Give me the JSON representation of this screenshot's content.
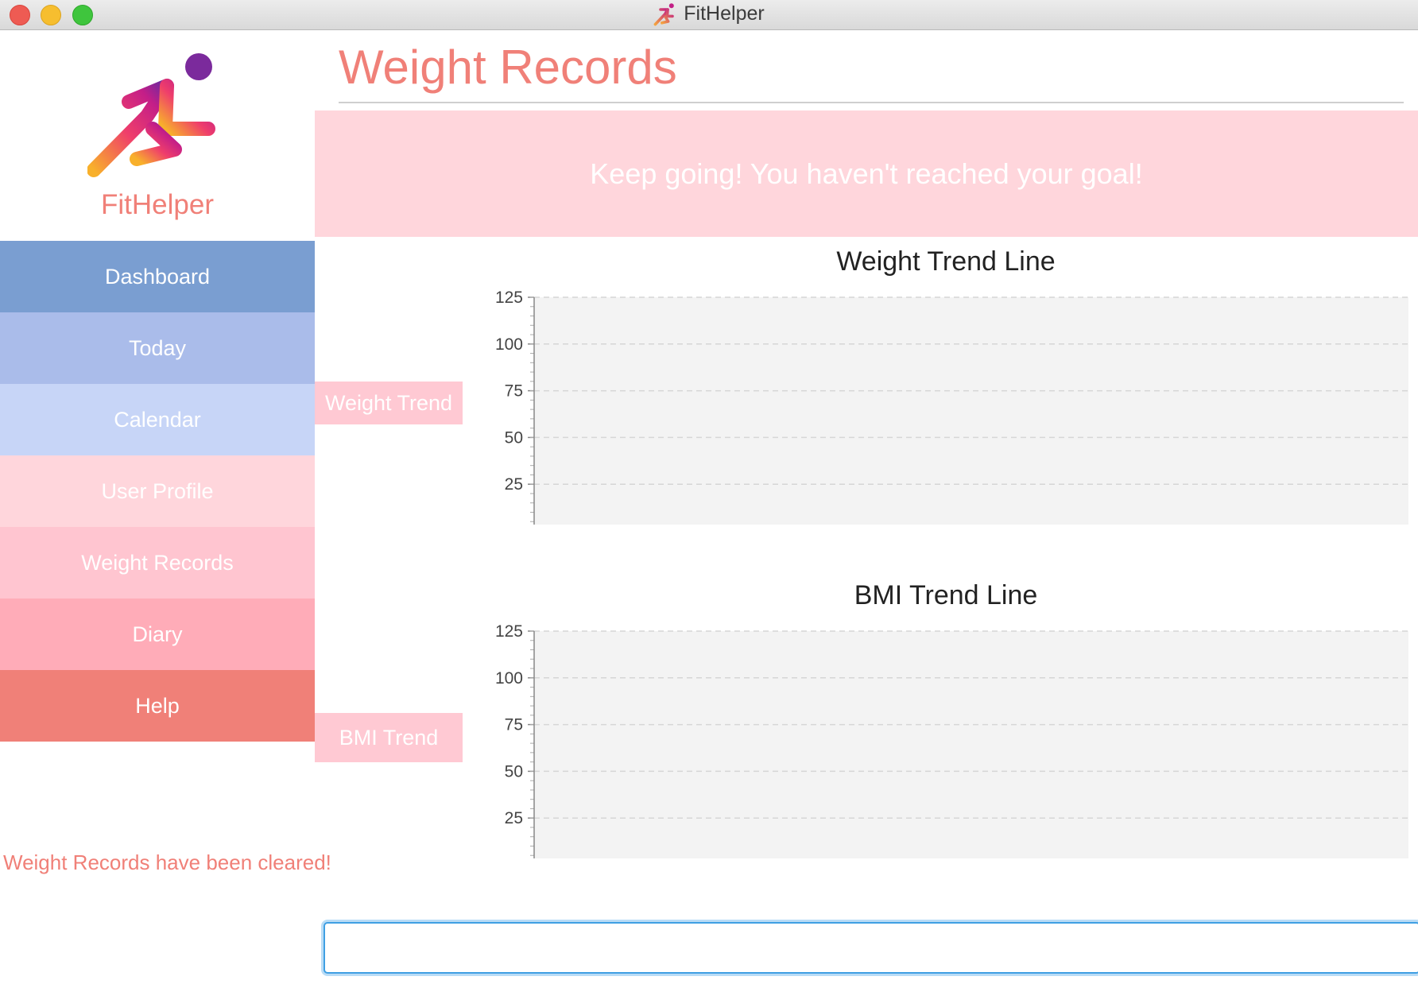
{
  "window": {
    "title": "FitHelper"
  },
  "sidebar": {
    "brand": "FitHelper",
    "logo_icon": "running-man-icon",
    "items": [
      {
        "label": "Dashboard",
        "color": "#7a9ed1"
      },
      {
        "label": "Today",
        "color": "#aabcea"
      },
      {
        "label": "Calendar",
        "color": "#c7d5f7"
      },
      {
        "label": "User Profile",
        "color": "#ffd6dc"
      },
      {
        "label": "Weight Records",
        "color": "#ffc5d0"
      },
      {
        "label": "Diary",
        "color": "#ffacb8"
      },
      {
        "label": "Help",
        "color": "#f08078"
      }
    ],
    "status_message": "Weight Records have been cleared!"
  },
  "main": {
    "page_title": "Weight Records",
    "banner": "Keep going! You haven't reached your goal!",
    "weight_tag": "Weight Trend",
    "bmi_tag": "BMI Trend",
    "command_input": {
      "value": "",
      "placeholder": ""
    }
  },
  "colors": {
    "accent": "#f08078",
    "banner_bg": "#ffd6dc",
    "tag_bg": "#ffc9d3",
    "input_focus": "#3f9fe3"
  },
  "chart_data": [
    {
      "type": "line",
      "title": "Weight Trend Line",
      "xlabel": "",
      "ylabel": "",
      "ylim": [
        0,
        125
      ],
      "yticks": [
        0,
        25,
        50,
        75,
        100,
        125
      ],
      "series": [],
      "grid": true
    },
    {
      "type": "line",
      "title": "BMI Trend Line",
      "xlabel": "",
      "ylabel": "",
      "ylim": [
        0,
        125
      ],
      "yticks": [
        0,
        25,
        50,
        75,
        100,
        125
      ],
      "series": [],
      "grid": true
    }
  ]
}
